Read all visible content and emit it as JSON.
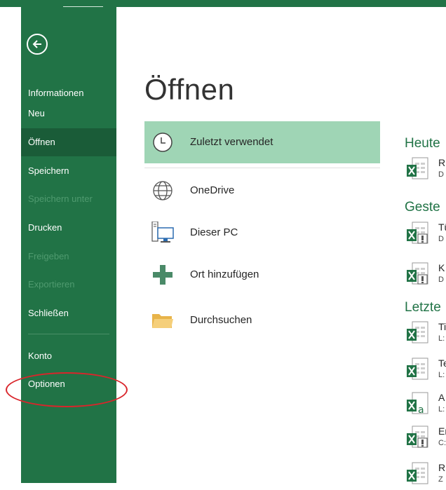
{
  "backstage": {
    "nav": {
      "informationen": "Informationen",
      "neu": "Neu",
      "oeffnen": "Öffnen",
      "speichern": "Speichern",
      "speichern_unter": "Speichern unter",
      "drucken": "Drucken",
      "freigeben": "Freigeben",
      "exportieren": "Exportieren",
      "schliessen": "Schließen",
      "konto": "Konto",
      "optionen": "Optionen"
    }
  },
  "main": {
    "title": "Öffnen",
    "locations": {
      "recent": "Zuletzt verwendet",
      "onedrive": "OneDrive",
      "this_pc": "Dieser PC",
      "add_place": "Ort hinzufügen",
      "browse": "Durchsuchen"
    },
    "sections": {
      "today": "Heute",
      "yesterday": "Geste",
      "older": "Letzte"
    },
    "files": [
      {
        "name": "R",
        "path": "D"
      },
      {
        "name": "Tü",
        "path": "D"
      },
      {
        "name": "K",
        "path": "D"
      },
      {
        "name": "Ti",
        "path": "L:"
      },
      {
        "name": "Te",
        "path": "L:"
      },
      {
        "name": "A",
        "path": "L:"
      },
      {
        "name": "Er",
        "path": "C:"
      },
      {
        "name": "R",
        "path": "Z"
      }
    ]
  },
  "colors": {
    "accent": "#217346",
    "active_nav": "#1a5c38",
    "selected_location": "#9fd5b5",
    "annotation_circle": "#d9252b"
  }
}
